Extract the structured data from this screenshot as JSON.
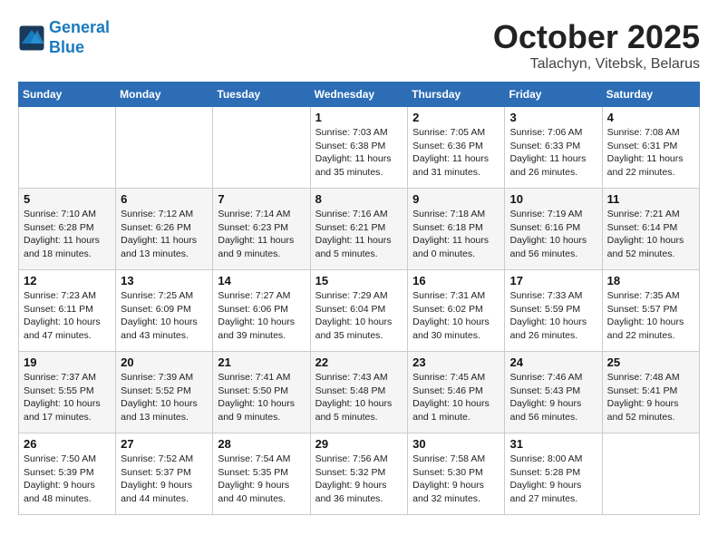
{
  "header": {
    "logo_line1": "General",
    "logo_line2": "Blue",
    "month_title": "October 2025",
    "location": "Talachyn, Vitebsk, Belarus"
  },
  "weekdays": [
    "Sunday",
    "Monday",
    "Tuesday",
    "Wednesday",
    "Thursday",
    "Friday",
    "Saturday"
  ],
  "weeks": [
    [
      {
        "day": "",
        "info": ""
      },
      {
        "day": "",
        "info": ""
      },
      {
        "day": "",
        "info": ""
      },
      {
        "day": "1",
        "info": "Sunrise: 7:03 AM\nSunset: 6:38 PM\nDaylight: 11 hours\nand 35 minutes."
      },
      {
        "day": "2",
        "info": "Sunrise: 7:05 AM\nSunset: 6:36 PM\nDaylight: 11 hours\nand 31 minutes."
      },
      {
        "day": "3",
        "info": "Sunrise: 7:06 AM\nSunset: 6:33 PM\nDaylight: 11 hours\nand 26 minutes."
      },
      {
        "day": "4",
        "info": "Sunrise: 7:08 AM\nSunset: 6:31 PM\nDaylight: 11 hours\nand 22 minutes."
      }
    ],
    [
      {
        "day": "5",
        "info": "Sunrise: 7:10 AM\nSunset: 6:28 PM\nDaylight: 11 hours\nand 18 minutes."
      },
      {
        "day": "6",
        "info": "Sunrise: 7:12 AM\nSunset: 6:26 PM\nDaylight: 11 hours\nand 13 minutes."
      },
      {
        "day": "7",
        "info": "Sunrise: 7:14 AM\nSunset: 6:23 PM\nDaylight: 11 hours\nand 9 minutes."
      },
      {
        "day": "8",
        "info": "Sunrise: 7:16 AM\nSunset: 6:21 PM\nDaylight: 11 hours\nand 5 minutes."
      },
      {
        "day": "9",
        "info": "Sunrise: 7:18 AM\nSunset: 6:18 PM\nDaylight: 11 hours\nand 0 minutes."
      },
      {
        "day": "10",
        "info": "Sunrise: 7:19 AM\nSunset: 6:16 PM\nDaylight: 10 hours\nand 56 minutes."
      },
      {
        "day": "11",
        "info": "Sunrise: 7:21 AM\nSunset: 6:14 PM\nDaylight: 10 hours\nand 52 minutes."
      }
    ],
    [
      {
        "day": "12",
        "info": "Sunrise: 7:23 AM\nSunset: 6:11 PM\nDaylight: 10 hours\nand 47 minutes."
      },
      {
        "day": "13",
        "info": "Sunrise: 7:25 AM\nSunset: 6:09 PM\nDaylight: 10 hours\nand 43 minutes."
      },
      {
        "day": "14",
        "info": "Sunrise: 7:27 AM\nSunset: 6:06 PM\nDaylight: 10 hours\nand 39 minutes."
      },
      {
        "day": "15",
        "info": "Sunrise: 7:29 AM\nSunset: 6:04 PM\nDaylight: 10 hours\nand 35 minutes."
      },
      {
        "day": "16",
        "info": "Sunrise: 7:31 AM\nSunset: 6:02 PM\nDaylight: 10 hours\nand 30 minutes."
      },
      {
        "day": "17",
        "info": "Sunrise: 7:33 AM\nSunset: 5:59 PM\nDaylight: 10 hours\nand 26 minutes."
      },
      {
        "day": "18",
        "info": "Sunrise: 7:35 AM\nSunset: 5:57 PM\nDaylight: 10 hours\nand 22 minutes."
      }
    ],
    [
      {
        "day": "19",
        "info": "Sunrise: 7:37 AM\nSunset: 5:55 PM\nDaylight: 10 hours\nand 17 minutes."
      },
      {
        "day": "20",
        "info": "Sunrise: 7:39 AM\nSunset: 5:52 PM\nDaylight: 10 hours\nand 13 minutes."
      },
      {
        "day": "21",
        "info": "Sunrise: 7:41 AM\nSunset: 5:50 PM\nDaylight: 10 hours\nand 9 minutes."
      },
      {
        "day": "22",
        "info": "Sunrise: 7:43 AM\nSunset: 5:48 PM\nDaylight: 10 hours\nand 5 minutes."
      },
      {
        "day": "23",
        "info": "Sunrise: 7:45 AM\nSunset: 5:46 PM\nDaylight: 10 hours\nand 1 minute."
      },
      {
        "day": "24",
        "info": "Sunrise: 7:46 AM\nSunset: 5:43 PM\nDaylight: 9 hours\nand 56 minutes."
      },
      {
        "day": "25",
        "info": "Sunrise: 7:48 AM\nSunset: 5:41 PM\nDaylight: 9 hours\nand 52 minutes."
      }
    ],
    [
      {
        "day": "26",
        "info": "Sunrise: 7:50 AM\nSunset: 5:39 PM\nDaylight: 9 hours\nand 48 minutes."
      },
      {
        "day": "27",
        "info": "Sunrise: 7:52 AM\nSunset: 5:37 PM\nDaylight: 9 hours\nand 44 minutes."
      },
      {
        "day": "28",
        "info": "Sunrise: 7:54 AM\nSunset: 5:35 PM\nDaylight: 9 hours\nand 40 minutes."
      },
      {
        "day": "29",
        "info": "Sunrise: 7:56 AM\nSunset: 5:32 PM\nDaylight: 9 hours\nand 36 minutes."
      },
      {
        "day": "30",
        "info": "Sunrise: 7:58 AM\nSunset: 5:30 PM\nDaylight: 9 hours\nand 32 minutes."
      },
      {
        "day": "31",
        "info": "Sunrise: 8:00 AM\nSunset: 5:28 PM\nDaylight: 9 hours\nand 27 minutes."
      },
      {
        "day": "",
        "info": ""
      }
    ]
  ]
}
